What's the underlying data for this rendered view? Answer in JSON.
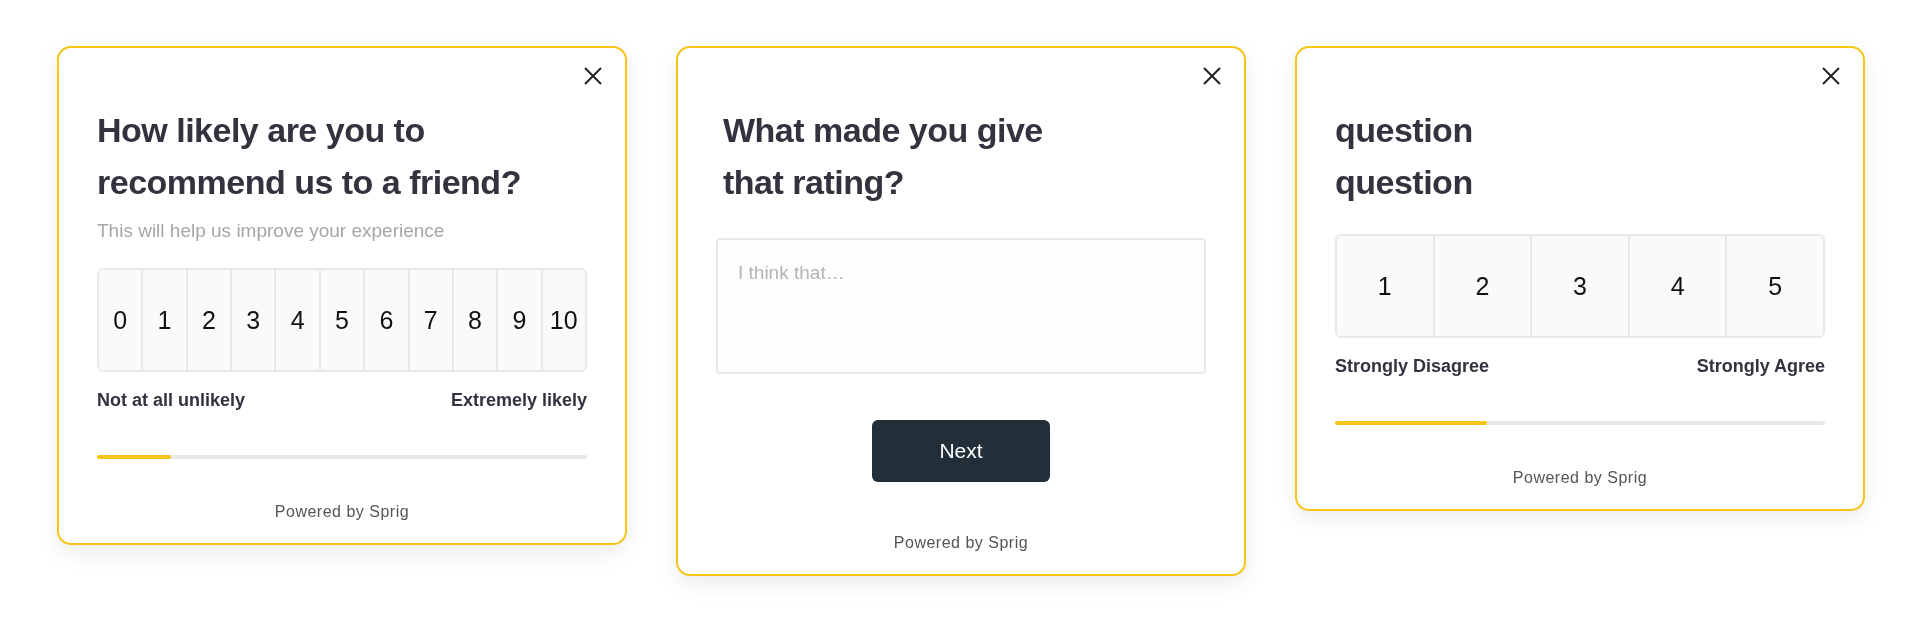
{
  "cards": [
    {
      "kind": "scale",
      "title": "How likely are you to\nrecommend us to a friend?",
      "subtitle": "This will help us improve your experience",
      "options": [
        {
          "label": "0"
        },
        {
          "label": "1"
        },
        {
          "label": "2"
        },
        {
          "label": "3"
        },
        {
          "label": "4"
        },
        {
          "label": "5"
        },
        {
          "label": "6"
        },
        {
          "label": "7"
        },
        {
          "label": "8"
        },
        {
          "label": "9"
        },
        {
          "label": "10"
        }
      ],
      "low_label": "Not at all unlikely",
      "high_label": "Extremely likely",
      "progress": {
        "level": 0.15
      },
      "footer": "Powered by Sprig"
    },
    {
      "kind": "open_text",
      "title": "What made you give\nthat rating?",
      "placeholder": "I think that…",
      "button": "Next",
      "footer": "Powered by Sprig"
    },
    {
      "kind": "scale",
      "title": "question\nquestion",
      "options": [
        {
          "label": "1"
        },
        {
          "label": "2"
        },
        {
          "label": "3"
        },
        {
          "label": "4"
        },
        {
          "label": "5"
        }
      ],
      "low_label": "Strongly Disagree",
      "high_label": "Strongly Agree",
      "progress": {
        "level": 0.31
      },
      "footer": "Powered by Sprig"
    }
  ]
}
